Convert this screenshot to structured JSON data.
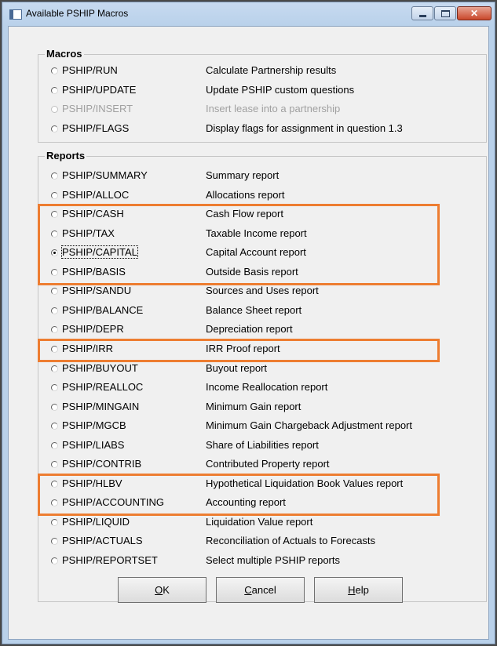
{
  "window": {
    "title": "Available PSHIP Macros"
  },
  "macros": {
    "title": "Macros",
    "items": [
      {
        "name": "PSHIP/RUN",
        "desc": "Calculate Partnership results",
        "enabled": true,
        "selected": false
      },
      {
        "name": "PSHIP/UPDATE",
        "desc": "Update PSHIP custom questions",
        "enabled": true,
        "selected": false
      },
      {
        "name": "PSHIP/INSERT",
        "desc": "Insert lease into a partnership",
        "enabled": false,
        "selected": false
      },
      {
        "name": "PSHIP/FLAGS",
        "desc": "Display flags for assignment in question 1.3",
        "enabled": true,
        "selected": false
      }
    ]
  },
  "reports": {
    "title": "Reports",
    "items": [
      {
        "name": "PSHIP/SUMMARY",
        "desc": "Summary report"
      },
      {
        "name": "PSHIP/ALLOC",
        "desc": "Allocations report"
      },
      {
        "name": "PSHIP/CASH",
        "desc": "Cash Flow report"
      },
      {
        "name": "PSHIP/TAX",
        "desc": "Taxable Income report"
      },
      {
        "name": "PSHIP/CAPITAL",
        "desc": "Capital Account report",
        "selected": true
      },
      {
        "name": "PSHIP/BASIS",
        "desc": "Outside Basis report"
      },
      {
        "name": "PSHIP/SANDU",
        "desc": "Sources and Uses report"
      },
      {
        "name": "PSHIP/BALANCE",
        "desc": "Balance Sheet report"
      },
      {
        "name": "PSHIP/DEPR",
        "desc": "Depreciation report"
      },
      {
        "name": "PSHIP/IRR",
        "desc": "IRR Proof report"
      },
      {
        "name": "PSHIP/BUYOUT",
        "desc": "Buyout report"
      },
      {
        "name": "PSHIP/REALLOC",
        "desc": "Income Reallocation report"
      },
      {
        "name": "PSHIP/MINGAIN",
        "desc": "Minimum Gain report"
      },
      {
        "name": "PSHIP/MGCB",
        "desc": "Minimum Gain Chargeback Adjustment report"
      },
      {
        "name": "PSHIP/LIABS",
        "desc": "Share of Liabilities report"
      },
      {
        "name": "PSHIP/CONTRIB",
        "desc": "Contributed Property report"
      },
      {
        "name": "PSHIP/HLBV",
        "desc": "Hypothetical Liquidation Book Values report"
      },
      {
        "name": "PSHIP/ACCOUNTING",
        "desc": "Accounting report"
      },
      {
        "name": "PSHIP/LIQUID",
        "desc": "Liquidation Value report"
      },
      {
        "name": "PSHIP/ACTUALS",
        "desc": "Reconciliation of Actuals to Forecasts"
      },
      {
        "name": "PSHIP/REPORTSET",
        "desc": "Select multiple PSHIP reports"
      }
    ]
  },
  "buttons": {
    "ok": {
      "label": "OK",
      "mnemonic": "O",
      "rest": "K"
    },
    "cancel": {
      "label": "Cancel",
      "mnemonic": "C",
      "rest": "ancel"
    },
    "help": {
      "label": "Help",
      "mnemonic": "H",
      "rest": "elp"
    }
  },
  "colors": {
    "highlight": "#ed7d31",
    "window_frame": "#b9d1ea",
    "dialog_bg": "#f0f0f0"
  }
}
